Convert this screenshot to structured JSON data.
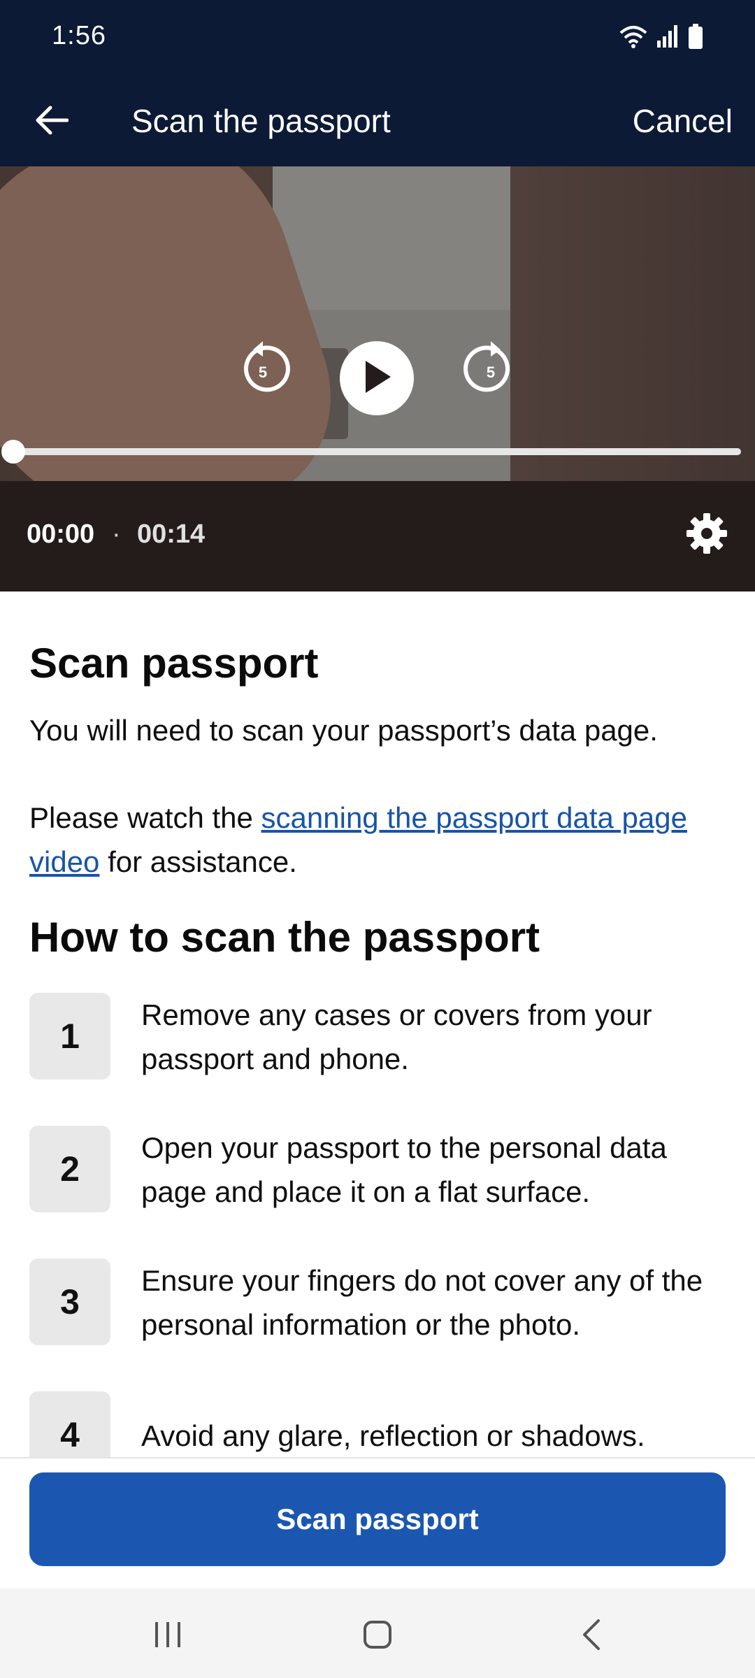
{
  "status_bar": {
    "time": "1:56"
  },
  "app_bar": {
    "title": "Scan the passport",
    "cancel_label": "Cancel"
  },
  "video": {
    "current_time": "00:00",
    "separator": "·",
    "duration": "00:14",
    "skip_back_seconds": "5",
    "skip_forward_seconds": "5",
    "progress_fraction": 0.0
  },
  "content": {
    "heading": "Scan passport",
    "intro": "You will need to scan your passport’s data page.",
    "watch_prefix": "Please watch the ",
    "watch_link": "scanning the passport data page video",
    "watch_suffix": " for assistance.",
    "steps_heading": "How to scan the passport",
    "steps": [
      {
        "number": "1",
        "text": "Remove any cases or covers from your passport and phone."
      },
      {
        "number": "2",
        "text": "Open your passport to the personal data page and place it on a flat surface."
      },
      {
        "number": "3",
        "text": "Ensure your fingers do not cover any of the personal information or the photo."
      },
      {
        "number": "4",
        "text": "Avoid any glare, reflection or shadows."
      }
    ]
  },
  "footer": {
    "primary_button_label": "Scan passport"
  },
  "colors": {
    "app_bar": "#0c1a35",
    "primary": "#1b57b0",
    "link": "#1854a8"
  },
  "icons": [
    "wifi-icon",
    "signal-icon",
    "battery-icon",
    "back-arrow-icon",
    "rewind-5-icon",
    "play-icon",
    "forward-5-icon",
    "settings-gear-icon",
    "recents-icon",
    "home-icon",
    "nav-back-icon"
  ]
}
